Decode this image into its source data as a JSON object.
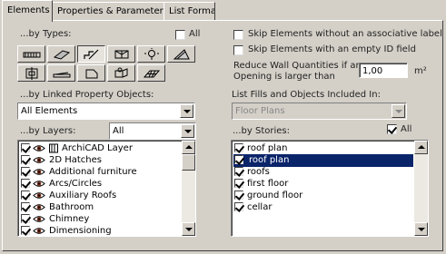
{
  "tabs": [
    {
      "label": "Elements",
      "active": true
    },
    {
      "label": "Properties & Parameters",
      "active": false
    },
    {
      "label": "List Format",
      "active": false
    }
  ],
  "by_types": {
    "label": "...by Types:",
    "all_label": "All",
    "all_checked": false,
    "type_icons": [
      "wall-icon",
      "column-icon",
      "beam-icon",
      "window-icon",
      "lamp-icon",
      "roof-icon",
      "slab-icon",
      "stair-icon",
      "door-icon",
      "object-icon",
      "mesh-icon"
    ],
    "pressed_icon": "beam-icon"
  },
  "options": {
    "skip_no_label": {
      "label": "Skip Elements without an associative label",
      "checked": false
    },
    "skip_empty_id": {
      "label": "Skip Elements with an empty ID field",
      "checked": false
    },
    "reduce_wall_label_line1": "Reduce Wall Quantities if an",
    "reduce_wall_label_line2": "Opening is larger than",
    "reduce_wall_value": "1,00",
    "reduce_wall_unit": "m²"
  },
  "linked_property": {
    "label": "...by Linked Property Objects:",
    "selected": "All Elements"
  },
  "list_fills": {
    "label": "List Fills and Objects Included In:",
    "selected": "Floor Plans",
    "disabled": true
  },
  "layers": {
    "label": "...by Layers:",
    "filter_selected": "All",
    "items": [
      {
        "label": "ArchiCAD Layer",
        "checked": true,
        "icon": "archicad-layer-icon"
      },
      {
        "label": "2D Hatches",
        "checked": true
      },
      {
        "label": "Additional furniture",
        "checked": true
      },
      {
        "label": "Arcs/Circles",
        "checked": true
      },
      {
        "label": "Auxiliary Roofs",
        "checked": true
      },
      {
        "label": "Bathroom",
        "checked": true
      },
      {
        "label": "Chimney",
        "checked": true
      },
      {
        "label": "Dimensioning",
        "checked": true
      }
    ]
  },
  "stories": {
    "label": "...by Stories:",
    "all_label": "All",
    "all_checked": true,
    "items": [
      {
        "label": "roof plan",
        "checked": true,
        "selected": false
      },
      {
        "label": "roof plan",
        "checked": true,
        "selected": true
      },
      {
        "label": "roofs",
        "checked": true,
        "selected": false
      },
      {
        "label": "first floor",
        "checked": true,
        "selected": false
      },
      {
        "label": "ground floor",
        "checked": true,
        "selected": false
      },
      {
        "label": "cellar",
        "checked": true,
        "selected": false
      }
    ]
  }
}
